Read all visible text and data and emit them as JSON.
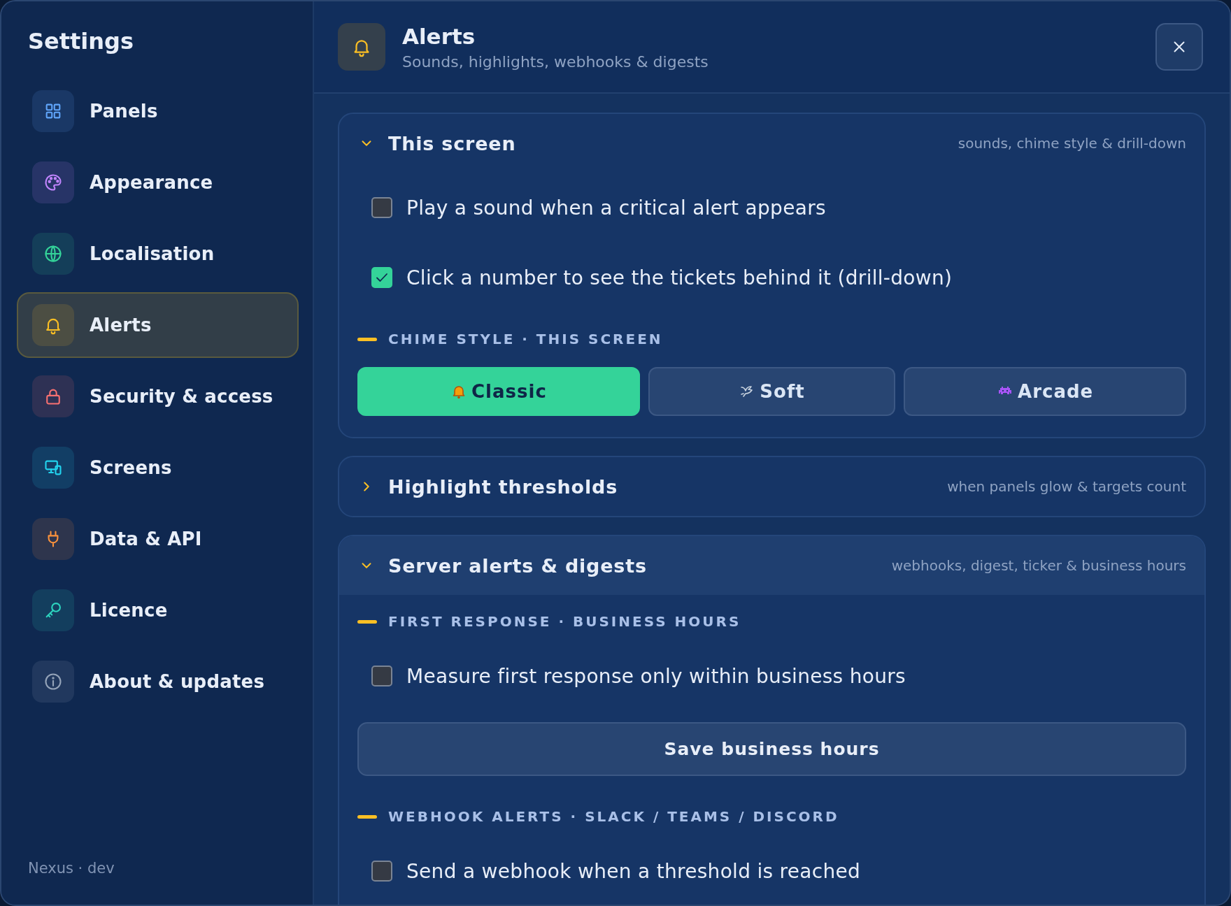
{
  "sidebar": {
    "title": "Settings",
    "items": [
      {
        "label": "Panels",
        "color": "#60a5fa",
        "selected": false
      },
      {
        "label": "Appearance",
        "color": "#c084fc",
        "selected": false
      },
      {
        "label": "Localisation",
        "color": "#34d399",
        "selected": false
      },
      {
        "label": "Alerts",
        "color": "#fbbf24",
        "selected": true
      },
      {
        "label": "Security & access",
        "color": "#f87171",
        "selected": false
      },
      {
        "label": "Screens",
        "color": "#22d3ee",
        "selected": false
      },
      {
        "label": "Data & API",
        "color": "#fb923c",
        "selected": false
      },
      {
        "label": "Licence",
        "color": "#2dd4bf",
        "selected": false
      },
      {
        "label": "About & updates",
        "color": "#94a3b8",
        "selected": false
      }
    ],
    "footer": "Nexus · dev"
  },
  "header": {
    "title": "Alerts",
    "subtitle": "Sounds, highlights, webhooks & digests"
  },
  "sections": [
    {
      "title": "This screen",
      "hint": "sounds, chime style & drill-down",
      "expanded": true,
      "highlighted": false,
      "blocks": [
        {
          "kind": "checkbox",
          "label": "Play a sound when a critical alert appears",
          "checked": false
        },
        {
          "kind": "checkbox",
          "label": "Click a number to see the tickets behind it (drill-down)",
          "checked": true
        },
        {
          "kind": "heading",
          "label": "CHIME STYLE · THIS SCREEN"
        },
        {
          "kind": "choices",
          "options": [
            {
              "label": "Classic",
              "selected": true
            },
            {
              "label": "Soft",
              "selected": false
            },
            {
              "label": "Arcade",
              "selected": false
            }
          ]
        }
      ]
    },
    {
      "title": "Highlight thresholds",
      "hint": "when panels glow & targets count",
      "expanded": false,
      "highlighted": false
    },
    {
      "title": "Server alerts & digests",
      "hint": "webhooks, digest, ticker & business hours",
      "expanded": true,
      "highlighted": true,
      "blocks": [
        {
          "kind": "heading",
          "label": "FIRST RESPONSE · BUSINESS HOURS"
        },
        {
          "kind": "checkbox",
          "label": "Measure first response only within business hours",
          "checked": false
        },
        {
          "kind": "button",
          "label": "Save business hours"
        },
        {
          "kind": "heading",
          "label": "WEBHOOK ALERTS · SLACK / TEAMS / DISCORD"
        },
        {
          "kind": "checkbox",
          "label": "Send a webhook when a threshold is reached",
          "checked": false
        }
      ]
    }
  ]
}
